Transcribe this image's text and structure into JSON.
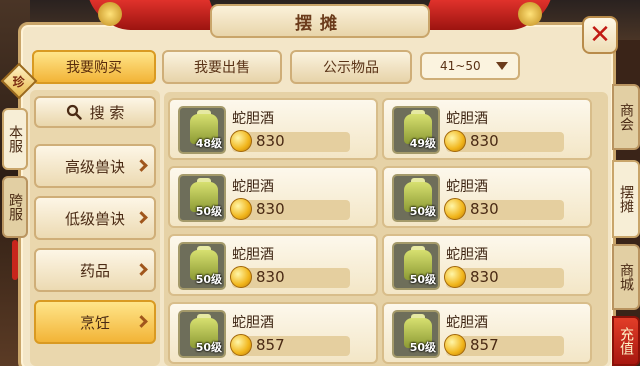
{
  "title": "摆摊",
  "close_icon": "close-x-icon",
  "top_tabs": [
    {
      "label": "我要购买",
      "active": true
    },
    {
      "label": "我要出售",
      "active": false
    },
    {
      "label": "公示物品",
      "active": false
    }
  ],
  "level_range": "41~50",
  "badge": "珍",
  "server_tabs": [
    {
      "label": "本服",
      "active": true
    },
    {
      "label": "跨服",
      "active": false
    }
  ],
  "search_label": "搜 索",
  "categories": [
    {
      "label": "高级兽诀",
      "active": false
    },
    {
      "label": "低级兽诀",
      "active": false
    },
    {
      "label": "药品",
      "active": false
    },
    {
      "label": "烹饪",
      "active": true
    }
  ],
  "items": [
    {
      "name": "蛇胆酒",
      "level": "48级",
      "price": "830"
    },
    {
      "name": "蛇胆酒",
      "level": "49级",
      "price": "830"
    },
    {
      "name": "蛇胆酒",
      "level": "50级",
      "price": "830"
    },
    {
      "name": "蛇胆酒",
      "level": "50级",
      "price": "830"
    },
    {
      "name": "蛇胆酒",
      "level": "50级",
      "price": "830"
    },
    {
      "name": "蛇胆酒",
      "level": "50级",
      "price": "830"
    },
    {
      "name": "蛇胆酒",
      "level": "50级",
      "price": "857"
    },
    {
      "name": "蛇胆酒",
      "level": "50级",
      "price": "857"
    }
  ],
  "side_tabs": [
    {
      "label": "商会",
      "state": "inactive"
    },
    {
      "label": "摆摊",
      "state": "active"
    },
    {
      "label": "商城",
      "state": "inactive"
    },
    {
      "label": "充值",
      "state": "red"
    }
  ],
  "colors": {
    "accent_gold": "#f2b437",
    "ribbon_red": "#c11a14",
    "parchment": "#f3e6c8"
  }
}
